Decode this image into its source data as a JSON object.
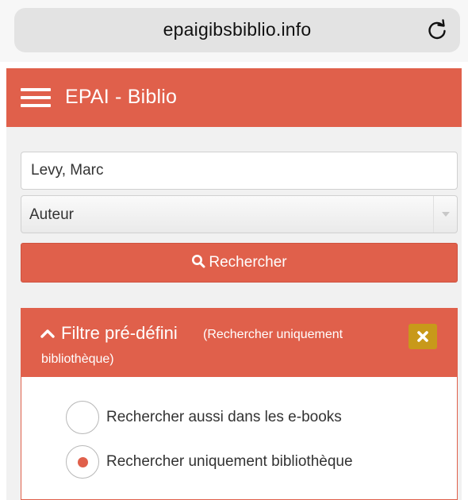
{
  "browser": {
    "url": "epaigibsbiblio.info",
    "reload_icon": "reload-icon"
  },
  "header": {
    "menu_icon": "hamburger-icon",
    "title": "EPAI - Biblio"
  },
  "search": {
    "query_value": "Levy, Marc",
    "search_type": "Auteur",
    "button_label": "Rechercher",
    "button_icon": "search-icon"
  },
  "filter": {
    "title": "Filtre pré-défini",
    "subtitle_line1": "(Rechercher uniquement",
    "subtitle_line2": "bibliothèque)",
    "collapse_icon": "chevron-up-icon",
    "close_icon": "close-icon",
    "options": [
      {
        "label": "Rechercher aussi dans les e-books",
        "selected": false
      },
      {
        "label": "Rechercher uniquement bibliothèque",
        "selected": true
      }
    ]
  },
  "colors": {
    "brand": "#e0604b",
    "close_button": "#c8991a",
    "background": "#f1f1f1"
  }
}
